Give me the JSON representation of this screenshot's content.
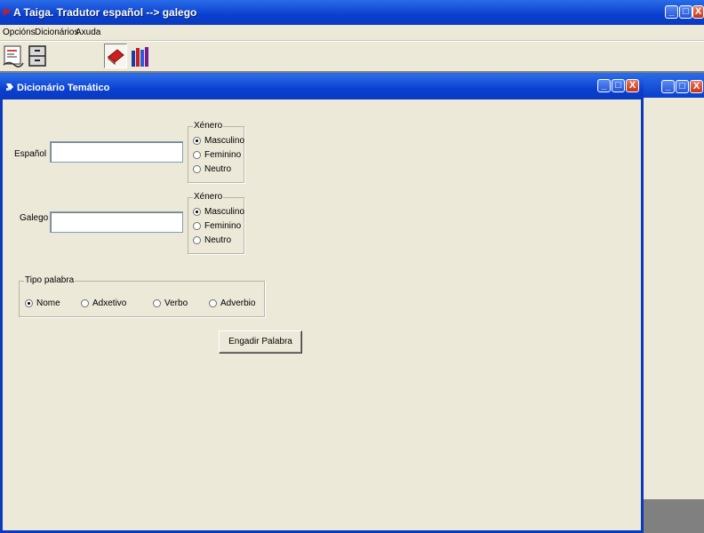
{
  "app": {
    "title": "A Taiga. Tradutor español  --> galego",
    "window_buttons": [
      "_",
      "□",
      "X"
    ]
  },
  "menubar": {
    "items": [
      {
        "label": "Opcións"
      },
      {
        "label": "Dicionários"
      },
      {
        "label": "Axuda"
      }
    ]
  },
  "toolbar": {
    "buttons": [
      {
        "icon": "translate-icon"
      },
      {
        "icon": "cabinet-icon"
      },
      {
        "icon": "book-icon",
        "pressed": true
      },
      {
        "icon": "books-icon"
      }
    ]
  },
  "child_window": {
    "title": "Dicionário Temático"
  },
  "form": {
    "espanol_label": "Español",
    "espanol_value": "",
    "galego_label": "Galego",
    "galego_value": "",
    "xenero1": {
      "legend": "Xénero",
      "options": [
        "Masculino",
        "Feminino",
        "Neutro"
      ],
      "selected": "Masculino"
    },
    "xenero2": {
      "legend": "Xénero",
      "options": [
        "Masculino",
        "Feminino",
        "Neutro"
      ],
      "selected": "Masculino"
    },
    "tipo_palabra": {
      "legend": "Tipo palabra",
      "options": [
        "Nome",
        "Adxetivo",
        "Verbo",
        "Adverbio"
      ],
      "selected": "Nome"
    },
    "submit_label": "Engadir Palabra"
  }
}
